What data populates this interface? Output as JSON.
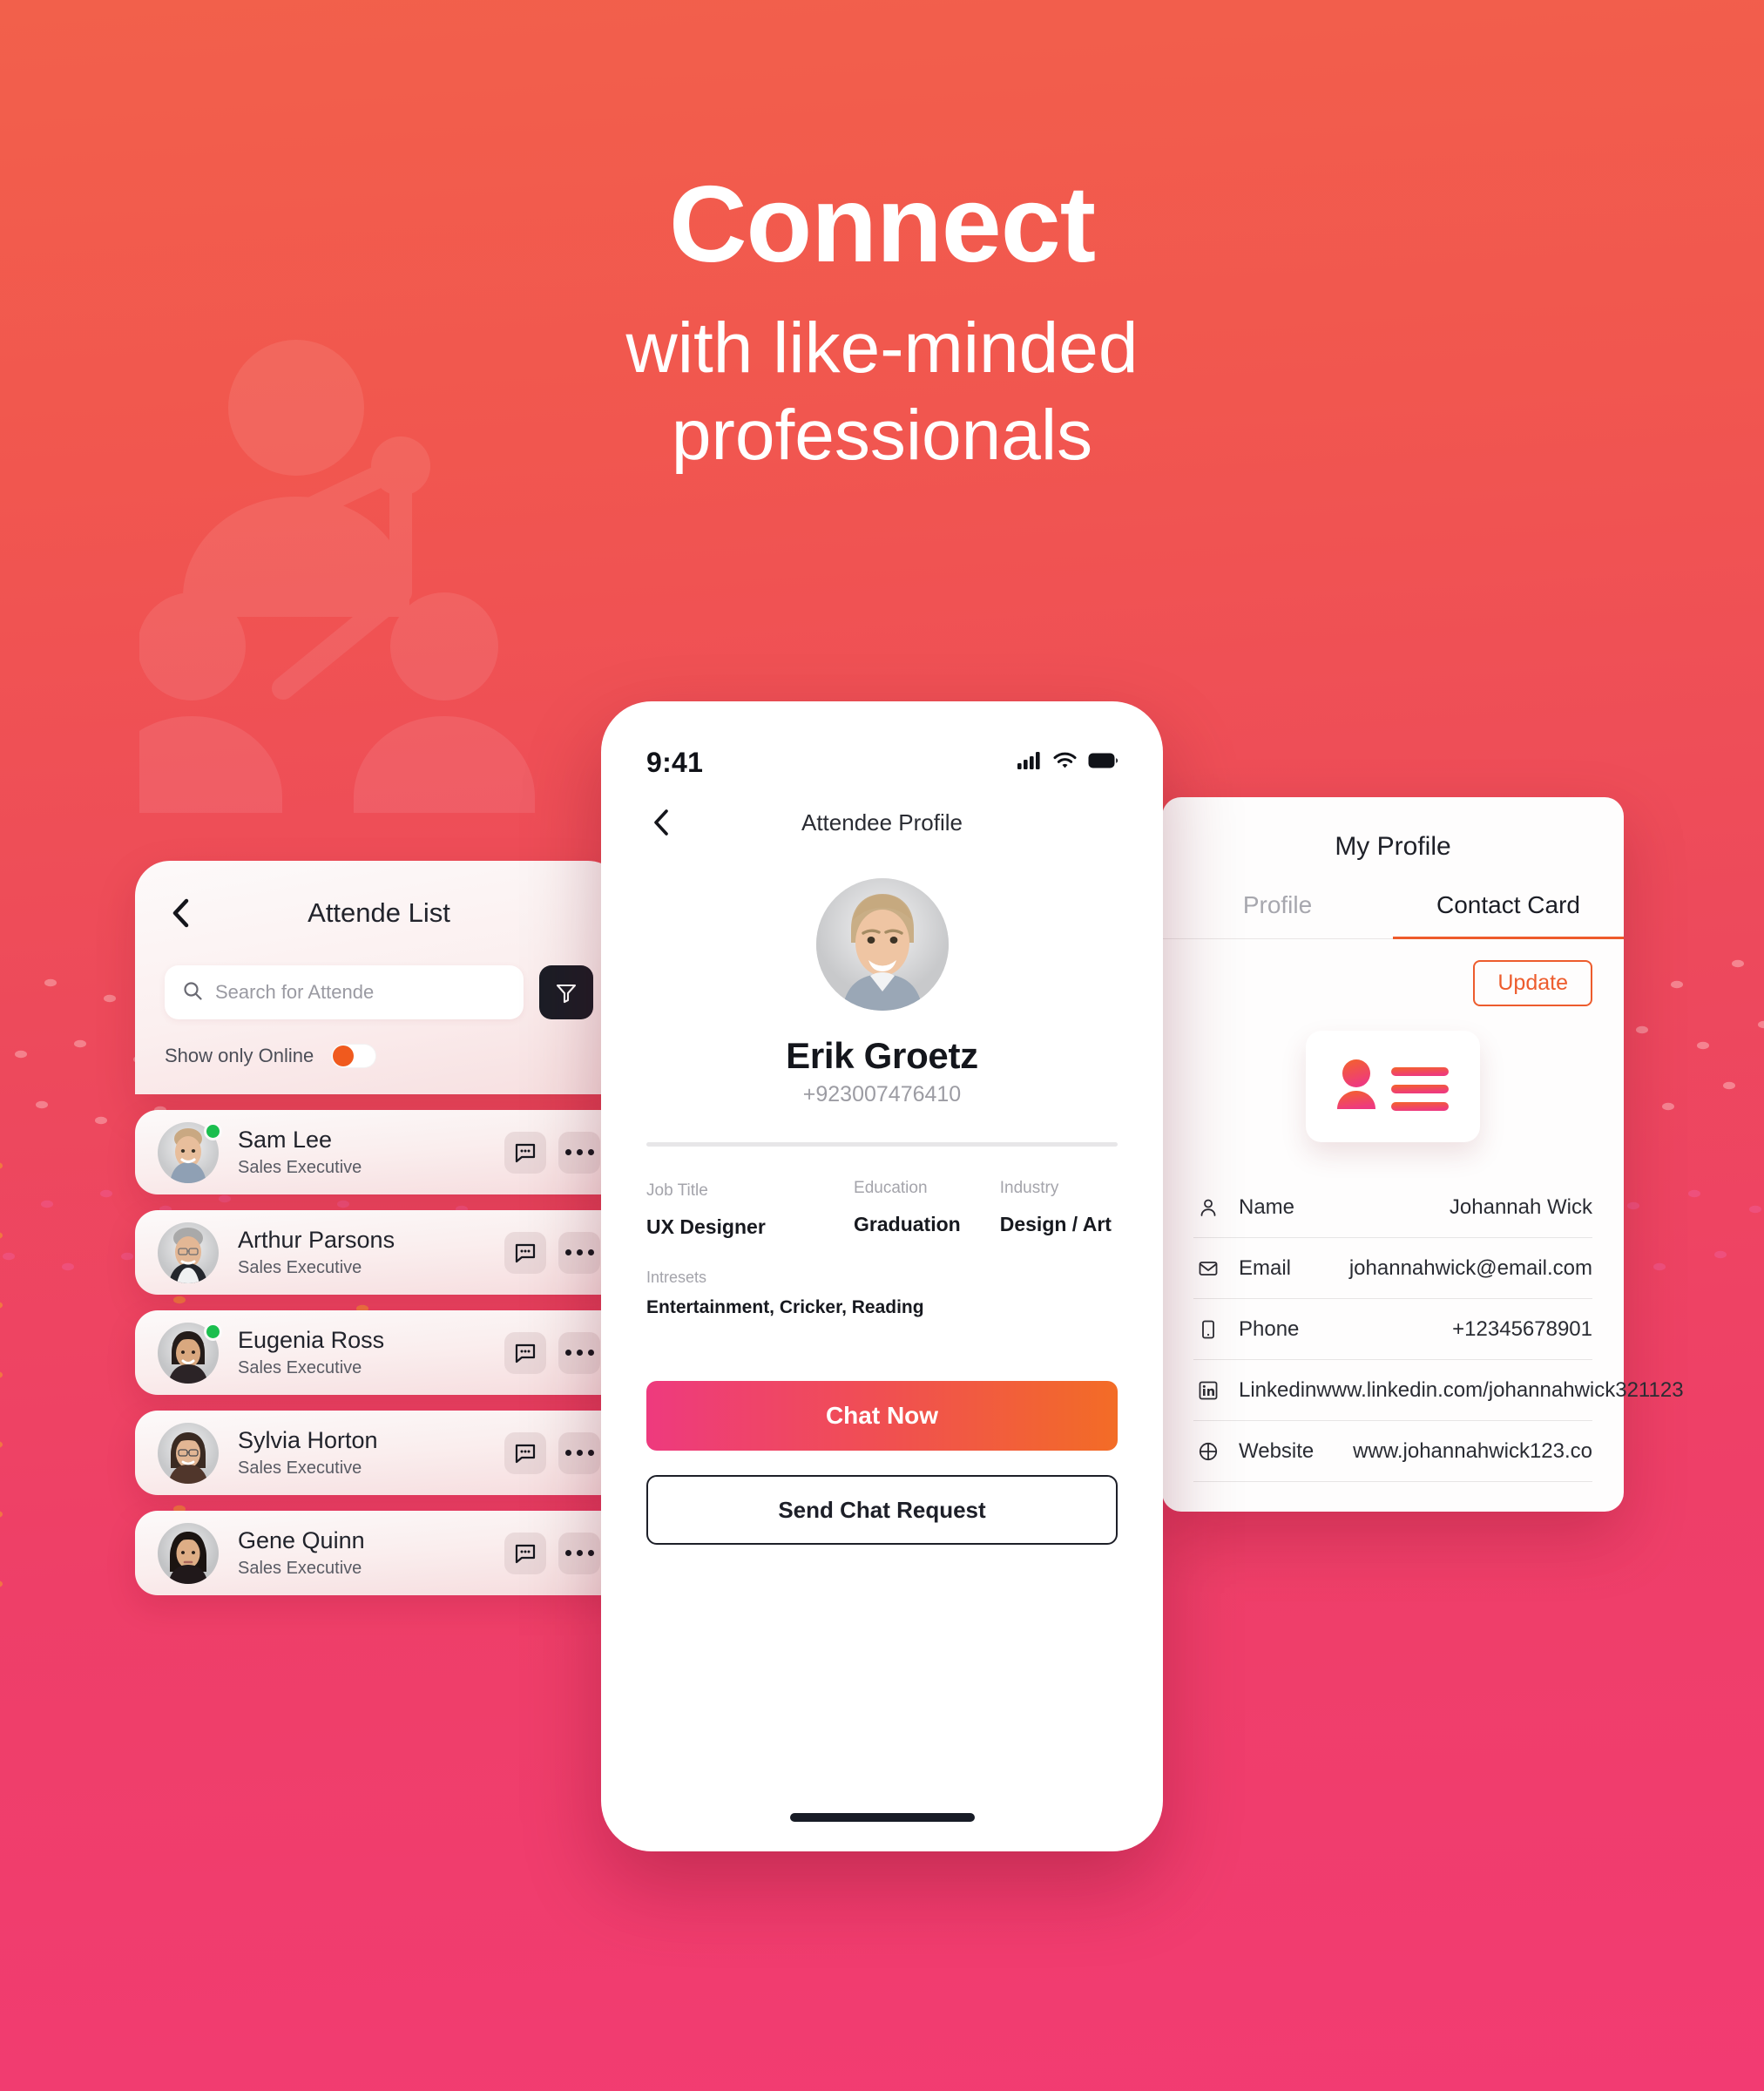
{
  "hero": {
    "title": "Connect",
    "subtitle_line1": "with like-minded",
    "subtitle_line2": "professionals"
  },
  "colors": {
    "bg_top": "#F2604B",
    "bg_bottom": "#F23B72",
    "accent_orange": "#EE5A2B",
    "accent_pink": "#EE3A7E",
    "online_green": "#1BBE4E",
    "toggle_knob": "#F05A1E",
    "dark": "#1B1D26"
  },
  "attendee_list": {
    "back_icon": "chevron-left-icon",
    "title": "Attende List",
    "search": {
      "icon": "search-icon",
      "placeholder": "Search for Attende",
      "value": ""
    },
    "filter_icon": "filter-funnel-icon",
    "toggle": {
      "label": "Show only Online",
      "state": "off"
    },
    "items": [
      {
        "name": "Sam Lee",
        "role": "Sales Executive",
        "online": true,
        "chat_icon": "chat-bubble-icon",
        "more_icon": "more-horizontal-icon"
      },
      {
        "name": "Arthur Parsons",
        "role": "Sales Executive",
        "online": false,
        "chat_icon": "chat-bubble-icon",
        "more_icon": "more-horizontal-icon"
      },
      {
        "name": "Eugenia Ross",
        "role": "Sales Executive",
        "online": true,
        "chat_icon": "chat-bubble-icon",
        "more_icon": "more-horizontal-icon"
      },
      {
        "name": "Sylvia Horton",
        "role": "Sales Executive",
        "online": false,
        "chat_icon": "chat-bubble-icon",
        "more_icon": "more-horizontal-icon"
      },
      {
        "name": "Gene Quinn",
        "role": "Sales Executive",
        "online": false,
        "chat_icon": "chat-bubble-icon",
        "more_icon": "more-horizontal-icon"
      }
    ]
  },
  "phone": {
    "status_bar": {
      "time": "9:41",
      "cellular_icon": "cellular-bars-icon",
      "wifi_icon": "wifi-icon",
      "battery_icon": "battery-full-icon"
    },
    "nav": {
      "back_icon": "chevron-left-icon",
      "title": "Attendee Profile"
    },
    "profile": {
      "avatar": "attendee-avatar",
      "name": "Erik Groetz",
      "phone": "+923007476410",
      "fields": [
        {
          "label": "Job Title",
          "value": "UX Designer"
        },
        {
          "label": "Education",
          "value": "Graduation"
        },
        {
          "label": "Industry",
          "value": "Design / Art"
        }
      ],
      "interests": {
        "label": "Intresets",
        "value": "Entertainment, Cricker, Reading"
      }
    },
    "actions": {
      "primary": "Chat Now",
      "secondary": "Send Chat Request"
    }
  },
  "my_profile": {
    "title": "My Profile",
    "tabs": [
      {
        "label": "Profile",
        "active": false
      },
      {
        "label": "Contact Card",
        "active": true
      }
    ],
    "update_button": "Update",
    "card_icon": "contact-card-icon",
    "rows": [
      {
        "icon": "person-icon",
        "label": "Name",
        "value": "Johannah Wick"
      },
      {
        "icon": "envelope-icon",
        "label": "Email",
        "value": "johannahwick@email.com"
      },
      {
        "icon": "phone-icon",
        "label": "Phone",
        "value": "+12345678901"
      },
      {
        "icon": "linkedin-icon",
        "label": "Linkedin",
        "value": "www.linkedin.com/johannahwick321123"
      },
      {
        "icon": "globe-icon",
        "label": "Website",
        "value": "www.johannahwick123.co"
      }
    ]
  }
}
